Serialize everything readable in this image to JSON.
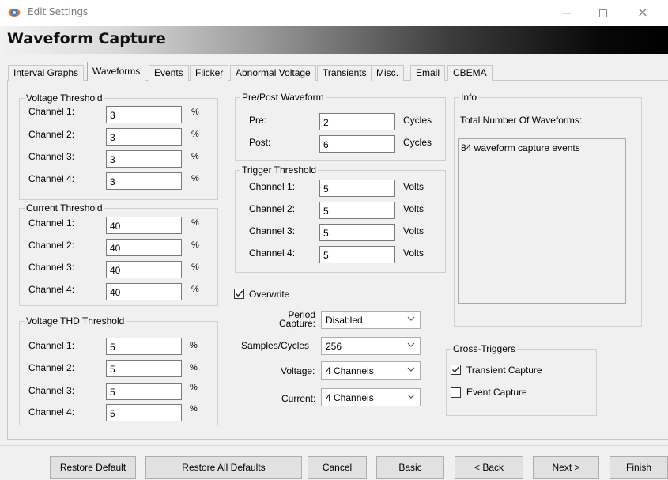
{
  "window": {
    "title": "Edit Settings",
    "minimize_icon": "minimize-icon",
    "maximize_icon": "maximize-icon",
    "close_icon": "close-icon",
    "close_symbol": "×",
    "app_icon": "eye-icon"
  },
  "header": {
    "title": "Waveform Capture"
  },
  "tabs": [
    "Interval Graphs",
    "Waveforms",
    "Events",
    "Flicker",
    "Abnormal Voltage",
    "Transients",
    "Misc.",
    "Email",
    "CBEMA"
  ],
  "active_tab": "Waveforms",
  "unit_percent": "%",
  "voltage_threshold": {
    "title": "Voltage Threshold",
    "channels": [
      {
        "label": "Channel 1:",
        "value": "3"
      },
      {
        "label": "Channel 2:",
        "value": "3"
      },
      {
        "label": "Channel 3:",
        "value": "3"
      },
      {
        "label": "Channel 4:",
        "value": "3"
      }
    ]
  },
  "current_threshold": {
    "title": "Current Threshold",
    "channels": [
      {
        "label": "Channel 1:",
        "value": "40"
      },
      {
        "label": "Channel 2:",
        "value": "40"
      },
      {
        "label": "Channel 3:",
        "value": "40"
      },
      {
        "label": "Channel 4:",
        "value": "40"
      }
    ]
  },
  "voltage_thd_threshold": {
    "title": "Voltage THD Threshold",
    "channels": [
      {
        "label": "Channel 1:",
        "value": "5"
      },
      {
        "label": "Channel 2:",
        "value": "5"
      },
      {
        "label": "Channel 3:",
        "value": "5"
      },
      {
        "label": "Channel 4:",
        "value": "5"
      }
    ]
  },
  "pre_post": {
    "title": "Pre/Post Waveform",
    "pre_label": "Pre:",
    "pre_value": "2",
    "post_label": "Post:",
    "post_value": "6",
    "unit": "Cycles"
  },
  "trigger_threshold": {
    "title": "Trigger Threshold",
    "unit": "Volts",
    "channels": [
      {
        "label": "Channel 1:",
        "value": "5"
      },
      {
        "label": "Channel 2:",
        "value": "5"
      },
      {
        "label": "Channel 3:",
        "value": "5"
      },
      {
        "label": "Channel 4:",
        "value": "5"
      }
    ]
  },
  "overwrite": {
    "label": "Overwrite",
    "checked": true
  },
  "period_capture": {
    "label_line1": "Period",
    "label_line2": "Capture:",
    "value": "Disabled"
  },
  "samples_cycles": {
    "label": "Samples/Cycles",
    "value": "256"
  },
  "voltage": {
    "label": "Voltage:",
    "value": "4 Channels"
  },
  "current": {
    "label": "Current:",
    "value": "4 Channels"
  },
  "info": {
    "title": "Info",
    "total_label": "Total Number Of Waveforms:",
    "list_text": "84 waveform capture events"
  },
  "cross_triggers": {
    "title": "Cross-Triggers",
    "transient_label": "Transient Capture",
    "transient_checked": true,
    "event_label": "Event Capture",
    "event_checked": false
  },
  "buttons": {
    "restore_default": "Restore Default",
    "restore_all": "Restore All Defaults",
    "cancel": "Cancel",
    "basic": "Basic",
    "back": "< Back",
    "next": "Next >",
    "finish": "Finish"
  }
}
